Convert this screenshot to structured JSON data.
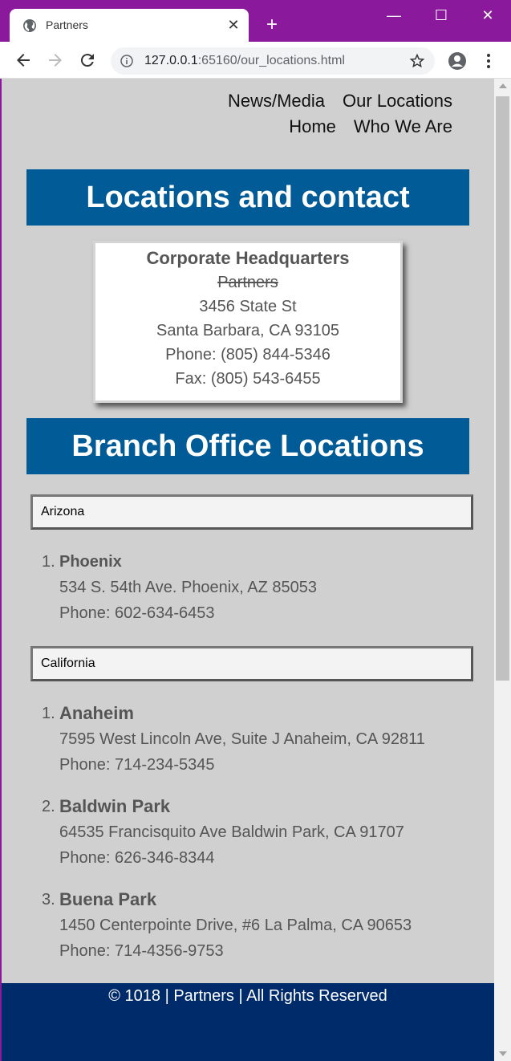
{
  "browser": {
    "tab_title": "Partners",
    "url_host": "127.0.0.1",
    "url_rest": ":65160/our_locations.html",
    "new_tab_symbol": "+",
    "close_symbol": "✕",
    "minimize_symbol": "—",
    "maximize_symbol": "☐",
    "window_close_symbol": "✕"
  },
  "nav": {
    "row1": [
      "News/Media",
      "Our Locations"
    ],
    "row2": [
      "Home",
      "Who We Are"
    ]
  },
  "page": {
    "heading": "Locations and contact",
    "branch_heading": "Branch Office Locations"
  },
  "hq": {
    "title": "Corporate Headquarters",
    "company": "Partners",
    "street": "3456 State St",
    "city": "Santa Barbara, CA 93105",
    "phone": "Phone: (805) 844-5346",
    "fax": "Fax: (805) 543-6455"
  },
  "states": [
    {
      "name": "Arizona",
      "offices": [
        {
          "num": "1.",
          "name": "Phoenix",
          "address": "534 S. 54th Ave. Phoenix, AZ 85053",
          "phone": "Phone: 602-634-6453"
        }
      ]
    },
    {
      "name": "California",
      "offices": [
        {
          "num": "1.",
          "name": "Anaheim",
          "address": "7595 West Lincoln Ave, Suite J Anaheim, CA 92811",
          "phone": "Phone: 714-234-5345"
        },
        {
          "num": "2.",
          "name": "Baldwin Park",
          "address": "64535 Francisquito Ave Baldwin Park, CA 91707",
          "phone": "Phone: 626-346-8344"
        },
        {
          "num": "3.",
          "name": "Buena Park",
          "address": "1450 Centerpointe Drive, #6 La Palma, CA 90653",
          "phone": "Phone: 714-4356-9753"
        }
      ]
    }
  ],
  "footer": {
    "text": "© 1018 | Partners | All Rights Reserved"
  },
  "colors": {
    "chrome": "#8a1a9b",
    "banner": "#005b96",
    "footer": "#002b6b",
    "page_bg": "#d0d0d0"
  }
}
